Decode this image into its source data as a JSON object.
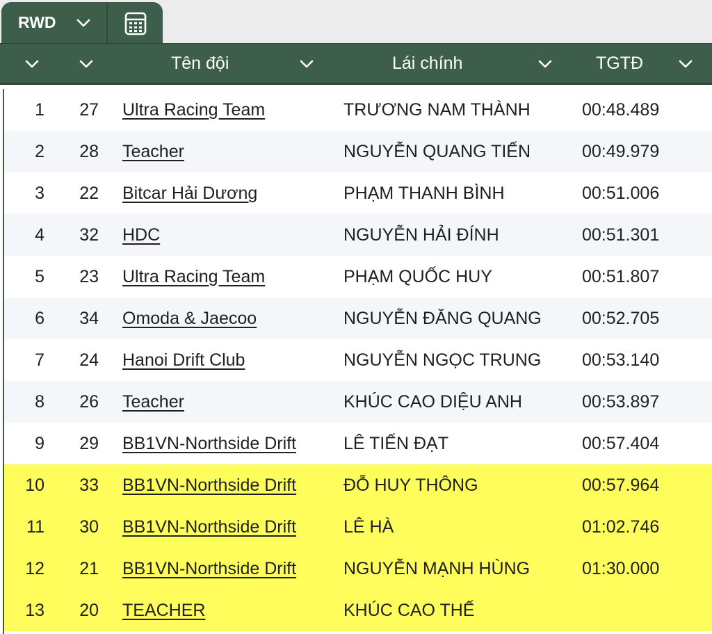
{
  "tab": {
    "sheet_label": "RWD",
    "chevron_icon": "chevron-down-icon",
    "calculator_icon": "calculator-icon"
  },
  "header": {
    "col_rank_label": "",
    "col_num_label": "",
    "col_team_label": "Tên đội",
    "col_driver_label": "Lái chính",
    "col_time_label": "TGTĐ"
  },
  "colors": {
    "header_bg": "#3d5e4a",
    "highlight": "#fefd5c",
    "alt_row": "#f4f6f9"
  },
  "rows": [
    {
      "rank": "1",
      "num": "27",
      "team": "Ultra Racing Team",
      "driver": "TRƯƠNG NAM THÀNH",
      "time": "00:48.489",
      "highlight": false
    },
    {
      "rank": "2",
      "num": "28",
      "team": "Teacher",
      "driver": "NGUYỄN QUANG TIẾN",
      "time": "00:49.979",
      "highlight": false
    },
    {
      "rank": "3",
      "num": "22",
      "team": "Bitcar Hải Dương",
      "driver": "PHẠM THANH BÌNH",
      "time": "00:51.006",
      "highlight": false
    },
    {
      "rank": "4",
      "num": "32",
      "team": "HDC",
      "driver": "NGUYỄN HẢI ĐÍNH",
      "time": "00:51.301",
      "highlight": false
    },
    {
      "rank": "5",
      "num": "23",
      "team": "Ultra Racing Team",
      "driver": "PHẠM QUỐC HUY",
      "time": "00:51.807",
      "highlight": false
    },
    {
      "rank": "6",
      "num": "34",
      "team": "Omoda & Jaecoo",
      "driver": "NGUYỄN ĐĂNG QUANG",
      "time": "00:52.705",
      "highlight": false
    },
    {
      "rank": "7",
      "num": "24",
      "team": "Hanoi Drift Club",
      "driver": "NGUYỄN NGỌC TRUNG",
      "time": "00:53.140",
      "highlight": false
    },
    {
      "rank": "8",
      "num": "26",
      "team": "Teacher",
      "driver": "KHÚC CAO DIỆU ANH",
      "time": "00:53.897",
      "highlight": false
    },
    {
      "rank": "9",
      "num": "29",
      "team": "BB1VN-Northside Drift",
      "driver": "LÊ TIẾN ĐẠT",
      "time": "00:57.404",
      "highlight": false
    },
    {
      "rank": "10",
      "num": "33",
      "team": "BB1VN-Northside Drift",
      "driver": "ĐỖ HUY THÔNG",
      "time": "00:57.964",
      "highlight": true
    },
    {
      "rank": "11",
      "num": "30",
      "team": "BB1VN-Northside Drift",
      "driver": "LÊ HÀ",
      "time": "01:02.746",
      "highlight": true
    },
    {
      "rank": "12",
      "num": "21",
      "team": "BB1VN-Northside Drift",
      "driver": "NGUYỄN MẠNH HÙNG",
      "time": "01:30.000",
      "highlight": true
    },
    {
      "rank": "13",
      "num": "20",
      "team": "TEACHER",
      "driver": "KHÚC CAO THẾ",
      "time": "",
      "highlight": true
    }
  ]
}
